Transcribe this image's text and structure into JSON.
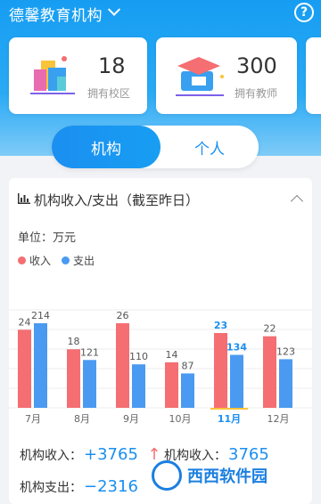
{
  "header": {
    "org_name": "德馨教育机构",
    "help": "?"
  },
  "stats": [
    {
      "value": "18",
      "label": "拥有校区"
    },
    {
      "value": "300",
      "label": "拥有教师"
    }
  ],
  "toggle": {
    "active": "机构",
    "inactive": "个人"
  },
  "card": {
    "title": "机构收入/支出（截至昨日）",
    "unit_label": "单位：万元",
    "legend": [
      {
        "name": "收入",
        "color": "#f46e72"
      },
      {
        "name": "支出",
        "color": "#4a9af1"
      }
    ]
  },
  "chart_data": {
    "type": "bar",
    "categories": [
      "7月",
      "8月",
      "9月",
      "10月",
      "11月",
      "12月"
    ],
    "series": [
      {
        "name": "收入",
        "values": [
          24,
          18,
          26,
          14,
          23,
          22
        ]
      },
      {
        "name": "支出",
        "values": [
          214,
          121,
          110,
          87,
          134,
          123
        ]
      }
    ],
    "highlight_category": "11月"
  },
  "summary": {
    "income_label": "机构收入：",
    "income_value": "+3765",
    "income_arrow": "↑",
    "income2_label": "机构收入：",
    "income2_value": "3765",
    "expense_label": "机构支出：",
    "expense_value": "−2316"
  },
  "watermark": "西西软件园"
}
